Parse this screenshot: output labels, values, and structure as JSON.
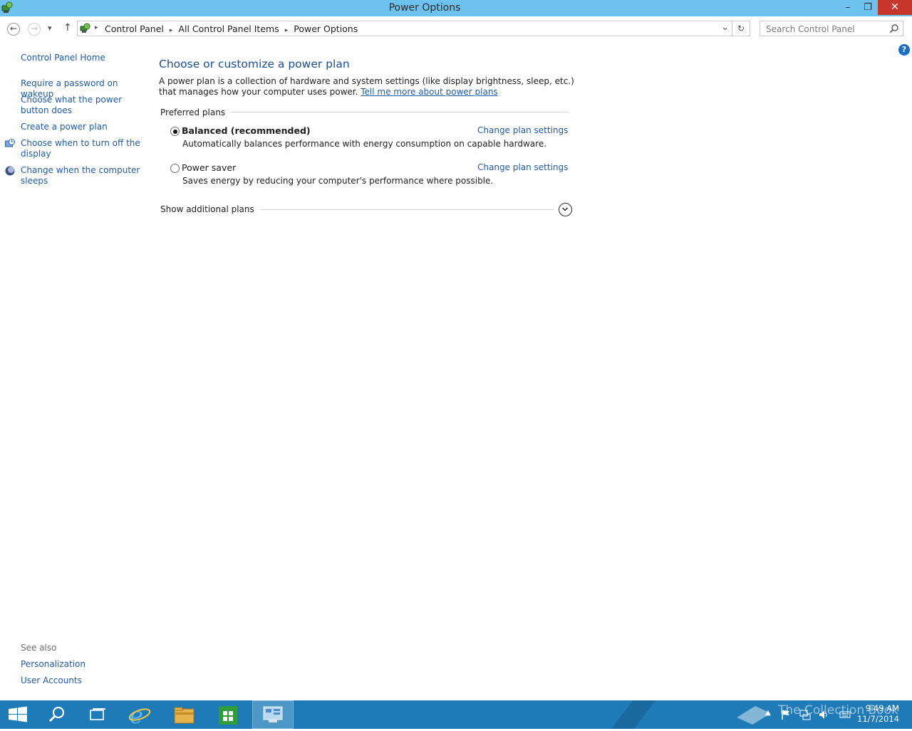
{
  "window": {
    "title": "Power Options",
    "controls": {
      "minimize": "–",
      "restore": "❐",
      "close": "✕"
    }
  },
  "navigation": {
    "back_glyph": "←",
    "forward_glyph": "→",
    "recent_glyph": "▾",
    "up_glyph": "↑",
    "breadcrumbs": [
      "Control Panel",
      "All Control Panel Items",
      "Power Options"
    ],
    "separator": "▸",
    "dropdown_glyph": "⌄",
    "refresh_glyph": "↻",
    "search_placeholder": "Search Control Panel",
    "search_icon": "magnifier-icon"
  },
  "sidebar": {
    "home": "Control Panel Home",
    "tasks": [
      {
        "label": "Require a password on wakeup",
        "icon": ""
      },
      {
        "label": "Choose what the power button does",
        "icon": ""
      },
      {
        "label": "Create a power plan",
        "icon": ""
      },
      {
        "label": "Choose when to turn off the display",
        "icon": "display-clock-icon"
      },
      {
        "label": "Change when the computer sleeps",
        "icon": "moon-sleep-icon"
      }
    ],
    "see_also_title": "See also",
    "see_also": [
      "Personalization",
      "User Accounts"
    ]
  },
  "main": {
    "title": "Choose or customize a power plan",
    "description": "A power plan is a collection of hardware and system settings (like display brightness, sleep, etc.) that manages how your computer uses power.",
    "description_link": "Tell me more about power plans",
    "preferred_label": "Preferred plans",
    "plans": [
      {
        "name": "Balanced (recommended)",
        "selected": true,
        "description": "Automatically balances performance with energy consumption on capable hardware.",
        "link": "Change plan settings"
      },
      {
        "name": "Power saver",
        "selected": false,
        "description": "Saves energy by reducing your computer's performance where possible.",
        "link": "Change plan settings"
      }
    ],
    "additional_label": "Show additional plans",
    "help_glyph": "?"
  },
  "taskbar": {
    "items": [
      "start-button",
      "search",
      "task-view",
      "internet-explorer",
      "file-explorer",
      "store",
      "control-panel"
    ],
    "time": "9:49 AM",
    "date": "11/7/2014",
    "watermark": "The Collection Book",
    "colors": {
      "taskbar": "#1f7bb7",
      "titlebar": "#6dc2ee",
      "link": "#1f5ca8"
    }
  }
}
